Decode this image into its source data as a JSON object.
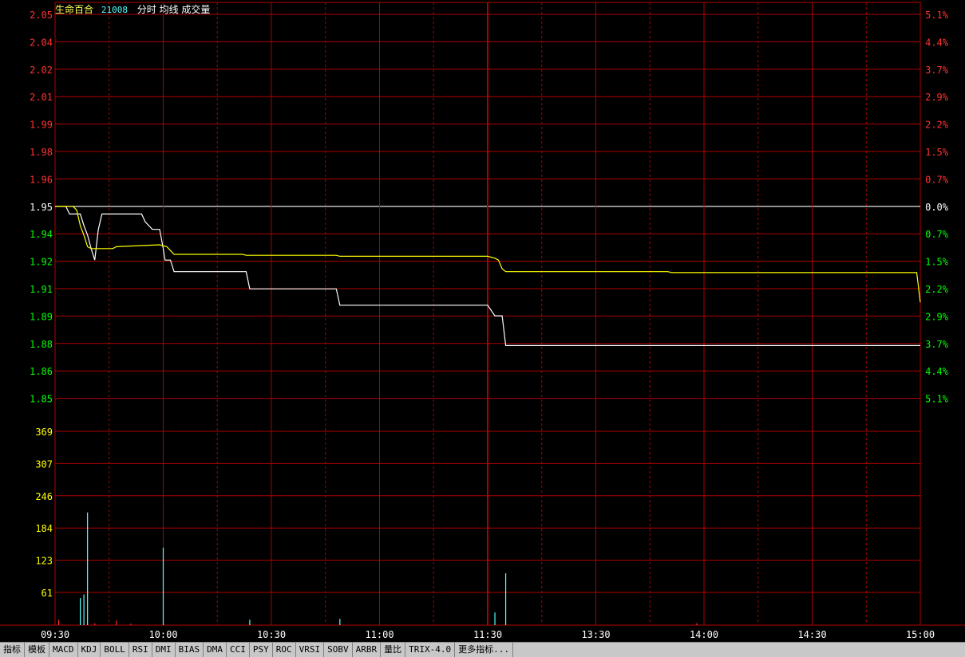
{
  "header": {
    "stock_name": "生命百合",
    "stock_code": "21008",
    "indicators": "分时 均线 成交量"
  },
  "tabs": [
    "指标",
    "模板",
    "MACD",
    "KDJ",
    "BOLL",
    "RSI",
    "DMI",
    "BIAS",
    "DMA",
    "CCI",
    "PSY",
    "ROC",
    "VRSI",
    "SOBV",
    "ARBR",
    "量比",
    "TRIX-4.0",
    "更多指标..."
  ],
  "colors": {
    "grid": "#b00000",
    "price_line": "#ffffff",
    "avg_line": "#ffff00",
    "up_text": "#ff3232",
    "down_text": "#00ff00",
    "neutral_text": "#ffffff",
    "volume_label": "#ffff00",
    "volume_bar": "#54ffff",
    "time_label": "#ffffff"
  },
  "chart_data": {
    "type": "line",
    "ref_price": 1.95,
    "price_axis": [
      "2.05",
      "2.04",
      "2.02",
      "2.01",
      "1.99",
      "1.98",
      "1.96",
      "1.95",
      "1.94",
      "1.92",
      "1.91",
      "1.89",
      "1.88",
      "1.86",
      "1.85"
    ],
    "pct_axis": [
      "5.1%",
      "4.4%",
      "3.7%",
      "2.9%",
      "2.2%",
      "1.5%",
      "0.7%",
      "0.0%",
      "0.7%",
      "1.5%",
      "2.2%",
      "2.9%",
      "3.7%",
      "4.4%",
      "5.1%"
    ],
    "ylim": [
      1.85,
      2.05
    ],
    "volume_axis": [
      "369",
      "307",
      "246",
      "184",
      "123",
      "61"
    ],
    "volume_ylim": [
      0,
      430
    ],
    "time_labels": [
      "09:30",
      "10:00",
      "10:30",
      "11:00",
      "11:30",
      "13:30",
      "14:00",
      "14:30",
      "15:00"
    ],
    "minutes_total": 240,
    "series": [
      {
        "name": "分时",
        "points": [
          [
            0,
            1.95
          ],
          [
            3,
            1.95
          ],
          [
            4,
            1.946
          ],
          [
            7,
            1.946
          ],
          [
            8,
            1.94
          ],
          [
            9,
            1.935
          ],
          [
            10,
            1.928
          ],
          [
            11,
            1.922
          ],
          [
            12,
            1.938
          ],
          [
            13,
            1.946
          ],
          [
            24,
            1.946
          ],
          [
            25,
            1.942
          ],
          [
            27,
            1.938
          ],
          [
            29,
            1.938
          ],
          [
            30,
            1.928
          ],
          [
            30.5,
            1.922
          ],
          [
            32,
            1.922
          ],
          [
            33,
            1.916
          ],
          [
            53,
            1.916
          ],
          [
            54,
            1.907
          ],
          [
            78,
            1.907
          ],
          [
            79,
            1.8985
          ],
          [
            120,
            1.8985
          ],
          [
            122,
            1.893
          ],
          [
            124,
            1.893
          ],
          [
            125,
            1.8775
          ],
          [
            240,
            1.8775
          ]
        ]
      },
      {
        "name": "均线",
        "points": [
          [
            0,
            1.95
          ],
          [
            5,
            1.95
          ],
          [
            6,
            1.948
          ],
          [
            7,
            1.94
          ],
          [
            8,
            1.935
          ],
          [
            9,
            1.929
          ],
          [
            10,
            1.928
          ],
          [
            16,
            1.928
          ],
          [
            17,
            1.929
          ],
          [
            29,
            1.93
          ],
          [
            31,
            1.929
          ],
          [
            32,
            1.927
          ],
          [
            33,
            1.925
          ],
          [
            52,
            1.925
          ],
          [
            53,
            1.9245
          ],
          [
            78,
            1.9245
          ],
          [
            79,
            1.924
          ],
          [
            120,
            1.924
          ],
          [
            122,
            1.923
          ],
          [
            123,
            1.922
          ],
          [
            124,
            1.9175
          ],
          [
            125,
            1.916
          ],
          [
            170,
            1.916
          ],
          [
            171,
            1.9155
          ],
          [
            239,
            1.9155
          ],
          [
            240,
            1.9
          ]
        ]
      }
    ],
    "volume": [
      [
        1,
        12,
        "red"
      ],
      [
        7,
        60,
        "cyan"
      ],
      [
        8,
        68,
        "cyan"
      ],
      [
        9,
        250,
        "cyan"
      ],
      [
        11,
        4,
        "red"
      ],
      [
        17,
        10,
        "red"
      ],
      [
        21,
        3,
        "red"
      ],
      [
        30,
        172,
        "cyan"
      ],
      [
        54,
        12,
        "cyan"
      ],
      [
        79,
        14,
        "cyan"
      ],
      [
        122,
        28,
        "cyan"
      ],
      [
        125,
        115,
        "cyan"
      ],
      [
        178,
        4,
        "red"
      ]
    ]
  }
}
